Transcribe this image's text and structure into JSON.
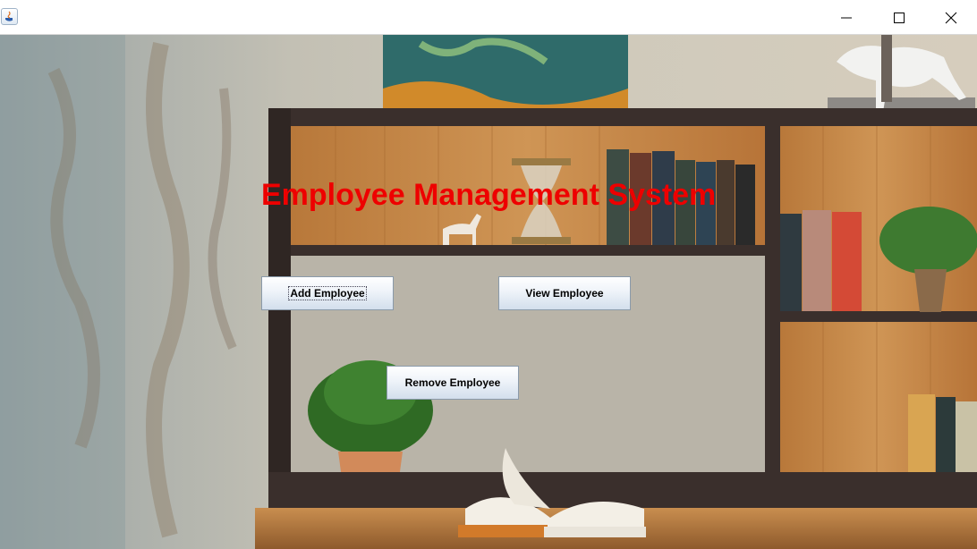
{
  "window": {
    "icons": {
      "app": "java-app-icon",
      "minimize": "minimize-icon",
      "maximize": "maximize-icon",
      "close": "close-icon"
    }
  },
  "main": {
    "heading": "Employee Management System",
    "heading_color": "#ee0000",
    "buttons": {
      "add": "Add Employee",
      "view": "View Employee",
      "remove": "Remove Employee"
    },
    "background_image": "bookshelf-interior"
  }
}
